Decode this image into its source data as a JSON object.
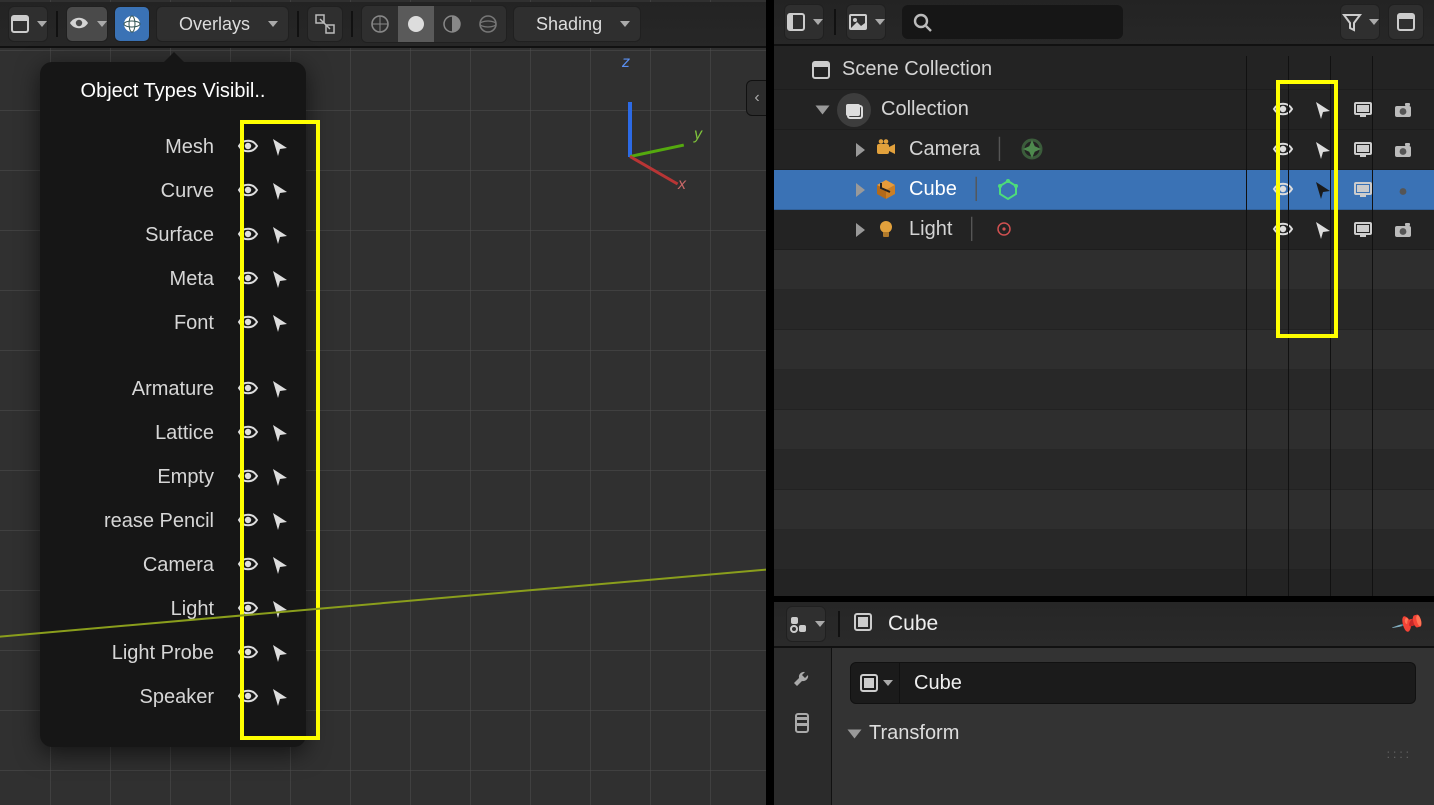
{
  "viewport_header": {
    "overlays_label": "Overlays",
    "shading_label": "Shading"
  },
  "gizmo": {
    "x": "x",
    "y": "y",
    "z": "z"
  },
  "popup": {
    "title": "Object Types Visibil..",
    "group1": [
      "Mesh",
      "Curve",
      "Surface",
      "Meta",
      "Font"
    ],
    "group2": [
      "Armature",
      "Lattice",
      "Empty",
      "rease Pencil",
      "Camera",
      "Light",
      "Light Probe",
      "Speaker"
    ]
  },
  "outliner": {
    "root": "Scene Collection",
    "collection": "Collection",
    "items": [
      {
        "name": "Camera",
        "icon": "camera",
        "selected": false
      },
      {
        "name": "Cube",
        "icon": "cube",
        "selected": true
      },
      {
        "name": "Light",
        "icon": "light",
        "selected": false
      }
    ]
  },
  "properties": {
    "header_name": "Cube",
    "object_name": "Cube",
    "panel": "Transform"
  }
}
